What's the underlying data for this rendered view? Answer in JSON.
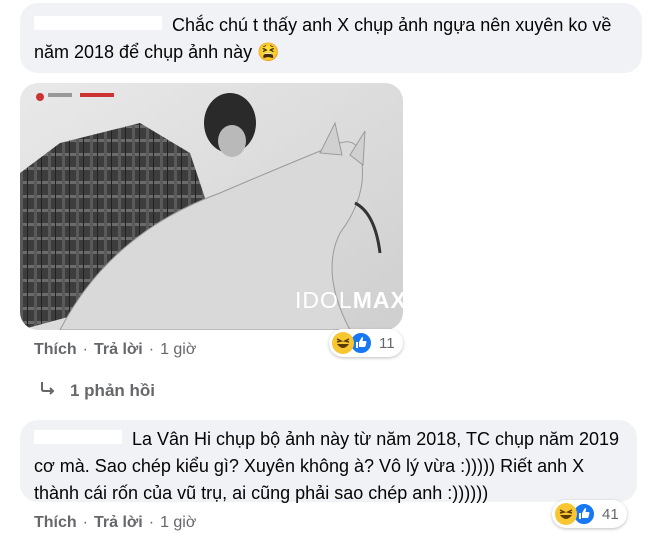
{
  "comments": [
    {
      "text": "Chắc chú t thấy anh X chụp ảnh ngựa nên xuyên ko về năm 2018 để chụp ảnh này 😫",
      "actions": {
        "like": "Thích",
        "reply": "Trả lời",
        "sep": "·",
        "time": "1 giờ"
      },
      "reactions": {
        "count": "11"
      },
      "photo": {
        "watermark_brand": "IDOLMAX",
        "watermark_idol": "IDOL",
        "watermark_max": "MAX"
      }
    },
    {
      "text": "La Vân Hi chụp bộ ảnh này từ năm 2018, TC chụp năm 2019 cơ mà. Sao chép kiểu gì? Xuyên không à? Vô lý vừa :))))) Riết anh X thành cái rốn của vũ trụ, ai cũng phải sao chép anh :))))))",
      "actions": {
        "like": "Thích",
        "reply": "Trả lời",
        "sep": "·",
        "time": "1 giờ"
      },
      "reactions": {
        "count": "41"
      }
    }
  ],
  "replies": {
    "label": "1 phản hồi"
  },
  "colors": {
    "bubble": "#f0f2f5",
    "meta": "#65676b",
    "like": "#1877f2",
    "haha": "#f7c631"
  }
}
